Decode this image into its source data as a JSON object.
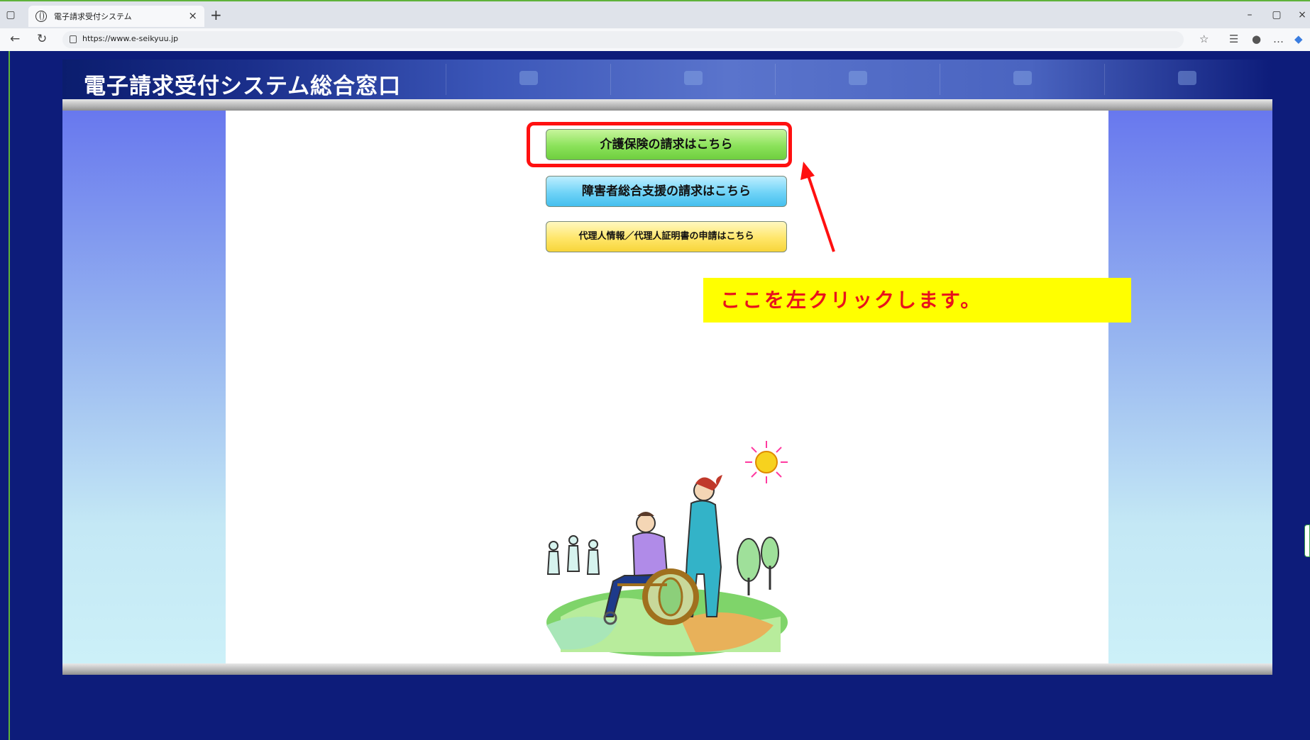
{
  "browser": {
    "tab_title": "電子請求受付システム",
    "tab_close": "×",
    "new_tab": "+",
    "url": "https://www.e-seikyuu.jp",
    "window_controls": {
      "minimize": "–",
      "restore": "▢",
      "close": "×"
    }
  },
  "page": {
    "header_title": "電子請求受付システム総合窓口",
    "buttons": {
      "kaigo": "介護保険の請求はこちら",
      "shogai": "障害者総合支援の請求はこちら",
      "dairinin": "代理人情報／代理人証明書の申請はこちら"
    },
    "annotation": "ここを左クリックします。"
  },
  "colors": {
    "background": "#0d1c7a",
    "highlight": "#ff1010",
    "callout_bg": "#ffff00",
    "callout_text": "#e8131c"
  },
  "icons": [
    "tab-actions-icon",
    "globe-icon",
    "back-arrow-icon",
    "reload-icon",
    "lock-icon",
    "favorite-icon",
    "collections-icon",
    "profile-icon",
    "more-icon",
    "copilot-icon"
  ]
}
